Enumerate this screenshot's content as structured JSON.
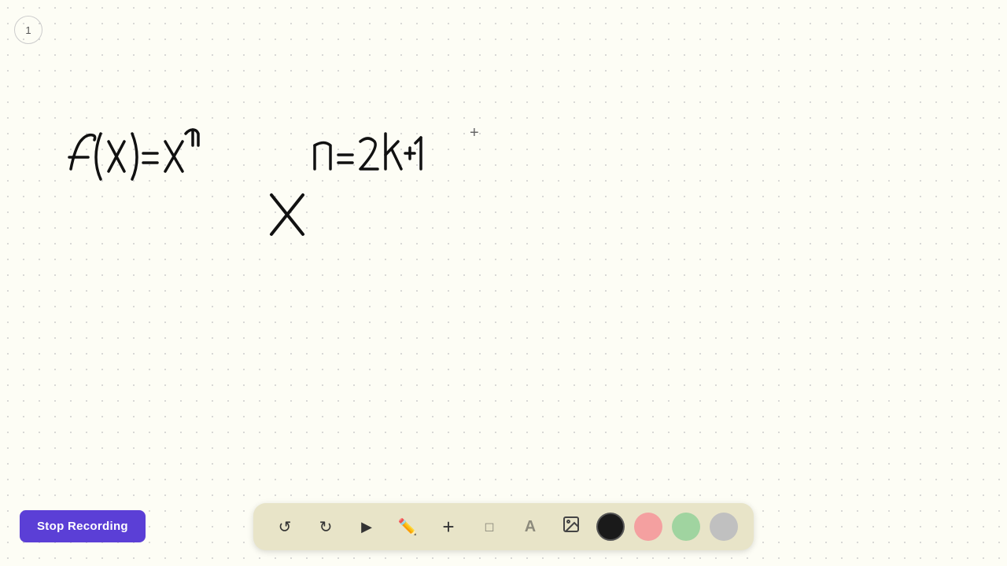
{
  "page": {
    "number": "1",
    "background_color": "#fdfdf5",
    "dot_color": "#cccccc"
  },
  "canvas": {
    "math_expressions": [
      {
        "id": "fx_expr",
        "text": "f(x)=xⁿ",
        "display": "f (x)=xⁿ"
      },
      {
        "id": "n_expr",
        "text": "n=2k+1",
        "display": "n=2k₊₁"
      },
      {
        "id": "x_symbol",
        "text": "X",
        "display": "X"
      }
    ],
    "cursor": "+"
  },
  "toolbar": {
    "tools": [
      {
        "id": "undo",
        "icon": "↺",
        "label": "Undo",
        "interactable": true
      },
      {
        "id": "redo",
        "icon": "↻",
        "label": "Redo",
        "interactable": true
      },
      {
        "id": "select",
        "icon": "▲",
        "label": "Select",
        "interactable": true
      },
      {
        "id": "pen",
        "icon": "✏",
        "label": "Pen",
        "interactable": true
      },
      {
        "id": "add",
        "icon": "+",
        "label": "Add",
        "interactable": true
      },
      {
        "id": "eraser",
        "icon": "◻",
        "label": "Eraser",
        "interactable": true
      },
      {
        "id": "text",
        "icon": "A",
        "label": "Text",
        "interactable": true
      },
      {
        "id": "image",
        "icon": "🖼",
        "label": "Image",
        "interactable": true
      }
    ],
    "colors": [
      {
        "id": "black",
        "value": "#1a1a1a",
        "active": true
      },
      {
        "id": "pink",
        "value": "#f4a0a0",
        "active": false
      },
      {
        "id": "green",
        "value": "#a0d4a0",
        "active": false
      },
      {
        "id": "gray",
        "value": "#c0c0c0",
        "active": false
      }
    ]
  },
  "stop_recording_button": {
    "label": "Stop Recording",
    "bg_color": "#5b3fd6",
    "text_color": "#ffffff"
  }
}
